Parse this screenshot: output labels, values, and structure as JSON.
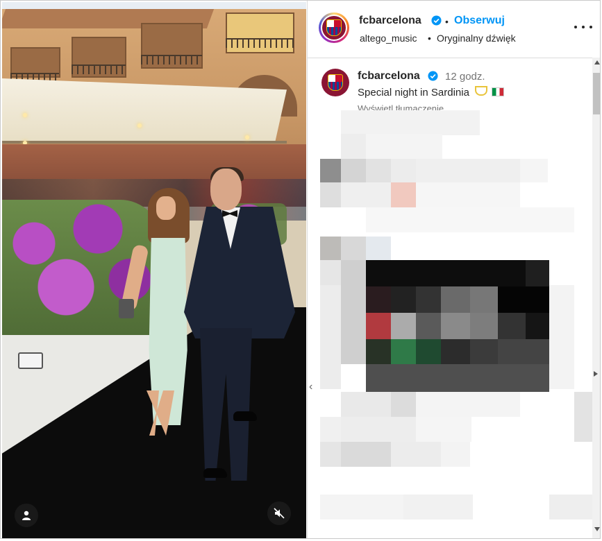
{
  "header": {
    "username": "fcbarcelona",
    "separator": "•",
    "follow_label": "Obserwuj",
    "audio_author": "altego_music",
    "audio_separator": "•",
    "audio_title": "Oryginalny dźwięk"
  },
  "post": {
    "username": "fcbarcelona",
    "time": "12 godz.",
    "caption": "Special night in Sardinia",
    "translate_label": "Wyświetl tłumaczenie"
  },
  "icons": {
    "verified": "verified-badge-icon",
    "more": "more-options-icon",
    "user_tag": "user-tag-icon",
    "mute": "audio-muted-icon",
    "emoji_hands": "heart-hands-emoji",
    "emoji_flag": "italy-flag-emoji"
  },
  "colors": {
    "link_blue": "#0095f6",
    "verified_blue": "#0095f6",
    "text": "#262626",
    "muted_text": "#737373",
    "border": "#dbdbdb"
  }
}
